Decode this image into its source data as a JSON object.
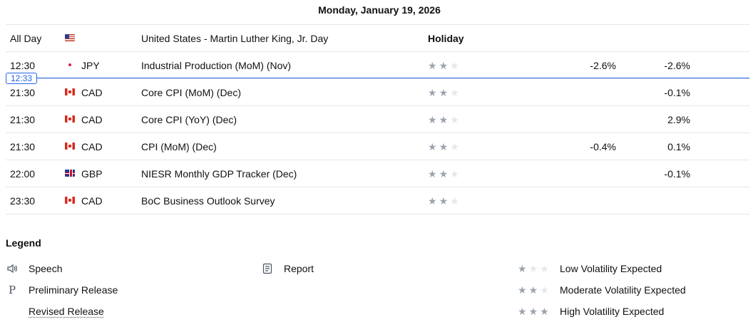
{
  "date_header": "Monday, January 19, 2026",
  "now_marker": "12:33",
  "holiday_row": {
    "time": "All Day",
    "flag": "us",
    "event": "United States - Martin Luther King, Jr. Day",
    "label": "Holiday"
  },
  "events": [
    {
      "time": "12:30",
      "flag": "jp",
      "currency": "JPY",
      "event": "Industrial Production (MoM) (Nov)",
      "importance": 2,
      "actual": "-2.6%",
      "forecast": "-2.6%"
    },
    {
      "time": "21:30",
      "flag": "ca",
      "currency": "CAD",
      "event": "Core CPI (MoM) (Dec)",
      "importance": 2,
      "actual": "",
      "forecast": "-0.1%"
    },
    {
      "time": "21:30",
      "flag": "ca",
      "currency": "CAD",
      "event": "Core CPI (YoY) (Dec)",
      "importance": 2,
      "actual": "",
      "forecast": "2.9%"
    },
    {
      "time": "21:30",
      "flag": "ca",
      "currency": "CAD",
      "event": "CPI (MoM) (Dec)",
      "importance": 2,
      "actual": "-0.4%",
      "forecast": "0.1%"
    },
    {
      "time": "22:00",
      "flag": "gb",
      "currency": "GBP",
      "event": "NIESR Monthly GDP Tracker  (Dec)",
      "importance": 2,
      "actual": "",
      "forecast": "-0.1%"
    },
    {
      "time": "23:30",
      "flag": "ca",
      "currency": "CAD",
      "event": "BoC Business Outlook Survey",
      "importance": 2,
      "actual": "",
      "forecast": ""
    }
  ],
  "legend": {
    "title": "Legend",
    "speech": {
      "icon": "speaker-icon",
      "label": "Speech"
    },
    "report": {
      "icon": "document-icon",
      "label": "Report"
    },
    "preliminary": {
      "icon": "P",
      "label": "Preliminary Release"
    },
    "revised": {
      "label": "Revised Release"
    },
    "low": {
      "stars": 1,
      "label": "Low Volatility Expected"
    },
    "moderate": {
      "stars": 2,
      "label": "Moderate Volatility Expected"
    },
    "high": {
      "stars": 3,
      "label": "High Volatility Expected"
    }
  },
  "colors": {
    "accent": "#2563eb",
    "star_on": "#9ca3af",
    "star_off": "#e5e7eb",
    "border": "#e5e7eb"
  }
}
